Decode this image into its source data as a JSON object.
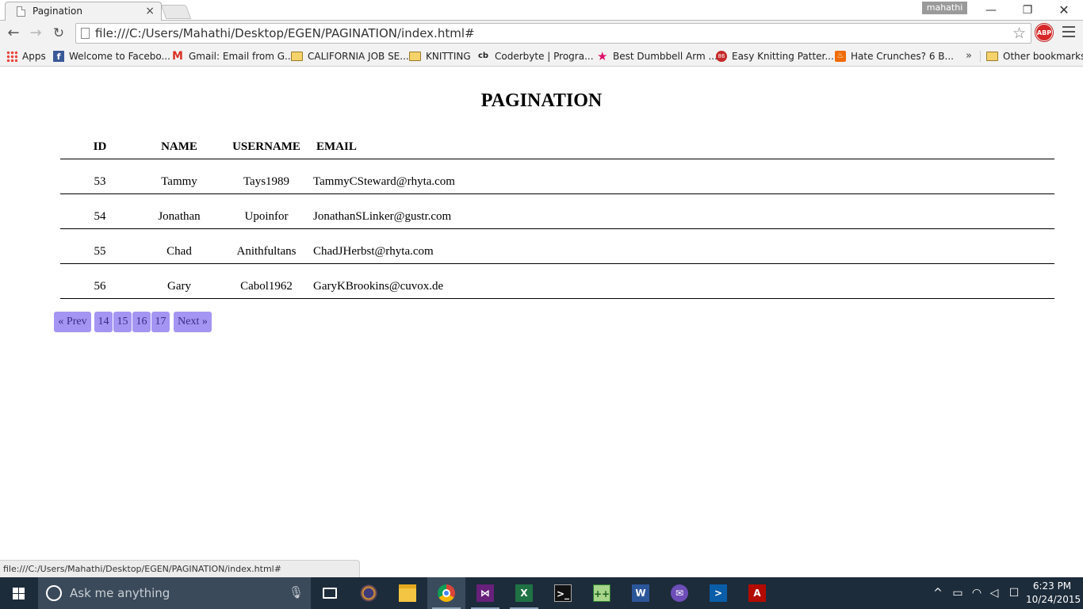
{
  "browser": {
    "tab_title": "Pagination",
    "tab_close": "×",
    "profile_name": "mahathi",
    "window_controls": {
      "minimize": "—",
      "restore": "❐",
      "close": "✕"
    },
    "nav": {
      "back": "←",
      "forward": "→",
      "reload": "↻"
    },
    "url": "file:///C:/Users/Mahathi/Desktop/EGEN/PAGINATION/index.html#",
    "star_icon": "☆",
    "abp_label": "ABP"
  },
  "bookmarks": {
    "items": [
      {
        "label": "Apps",
        "icon": "apps-grid-icon"
      },
      {
        "label": "Welcome to Facebo...",
        "icon": "facebook-icon",
        "glyph": "f"
      },
      {
        "label": "Gmail: Email from G...",
        "icon": "gmail-icon",
        "glyph": "M"
      },
      {
        "label": "CALIFORNIA JOB SE...",
        "icon": "folder-icon"
      },
      {
        "label": "KNITTING",
        "icon": "folder-icon"
      },
      {
        "label": "Coderbyte | Progra...",
        "icon": "coderbyte-icon",
        "glyph": "cb"
      },
      {
        "label": "Best Dumbbell Arm ...",
        "icon": "star-icon",
        "glyph": "★"
      },
      {
        "label": "Easy Knitting Patter...",
        "icon": "knitting-site-icon",
        "glyph": "86"
      },
      {
        "label": "Hate Crunches? 6 B...",
        "icon": "fire-icon",
        "glyph": "♨"
      }
    ],
    "more": "»",
    "other": "Other bookmarks"
  },
  "page": {
    "title": "PAGINATION",
    "table": {
      "headers": [
        "ID",
        "NAME",
        "USERNAME",
        "EMAIL"
      ],
      "rows": [
        [
          "53",
          "Tammy",
          "Tays1989",
          "TammyCSteward@rhyta.com"
        ],
        [
          "54",
          "Jonathan",
          "Upoinfor",
          "JonathanSLinker@gustr.com"
        ],
        [
          "55",
          "Chad",
          "Anithfultans",
          "ChadJHerbst@rhyta.com"
        ],
        [
          "56",
          "Gary",
          "Cabol1962",
          "GaryKBrookins@cuvox.de"
        ]
      ]
    },
    "pagination": {
      "prev": "« Prev",
      "pages": [
        "14",
        "15",
        "16",
        "17"
      ],
      "next": "Next »",
      "button_color": "#a595f3"
    }
  },
  "status_bar": "file:///C:/Users/Mahathi/Desktop/EGEN/PAGINATION/index.html#",
  "taskbar": {
    "search_placeholder": "Ask me anything",
    "apps": [
      {
        "name": "task-view",
        "glyph": ""
      },
      {
        "name": "eclipse",
        "glyph": ""
      },
      {
        "name": "file-explorer",
        "glyph": ""
      },
      {
        "name": "chrome",
        "glyph": ""
      },
      {
        "name": "visual-studio",
        "glyph": "⋈"
      },
      {
        "name": "excel",
        "glyph": "X"
      },
      {
        "name": "command-prompt",
        "glyph": ">_"
      },
      {
        "name": "notepad-plus-plus",
        "glyph": "++"
      },
      {
        "name": "word",
        "glyph": "W"
      },
      {
        "name": "mail",
        "glyph": "✉"
      },
      {
        "name": "powershell",
        "glyph": ">"
      },
      {
        "name": "acrobat",
        "glyph": "A"
      }
    ],
    "tray": {
      "chevron": "^",
      "battery": "▭",
      "wifi": "◠",
      "volume": "◁",
      "notifications": "☐"
    },
    "clock": {
      "time": "6:23 PM",
      "date": "10/24/2015"
    }
  }
}
